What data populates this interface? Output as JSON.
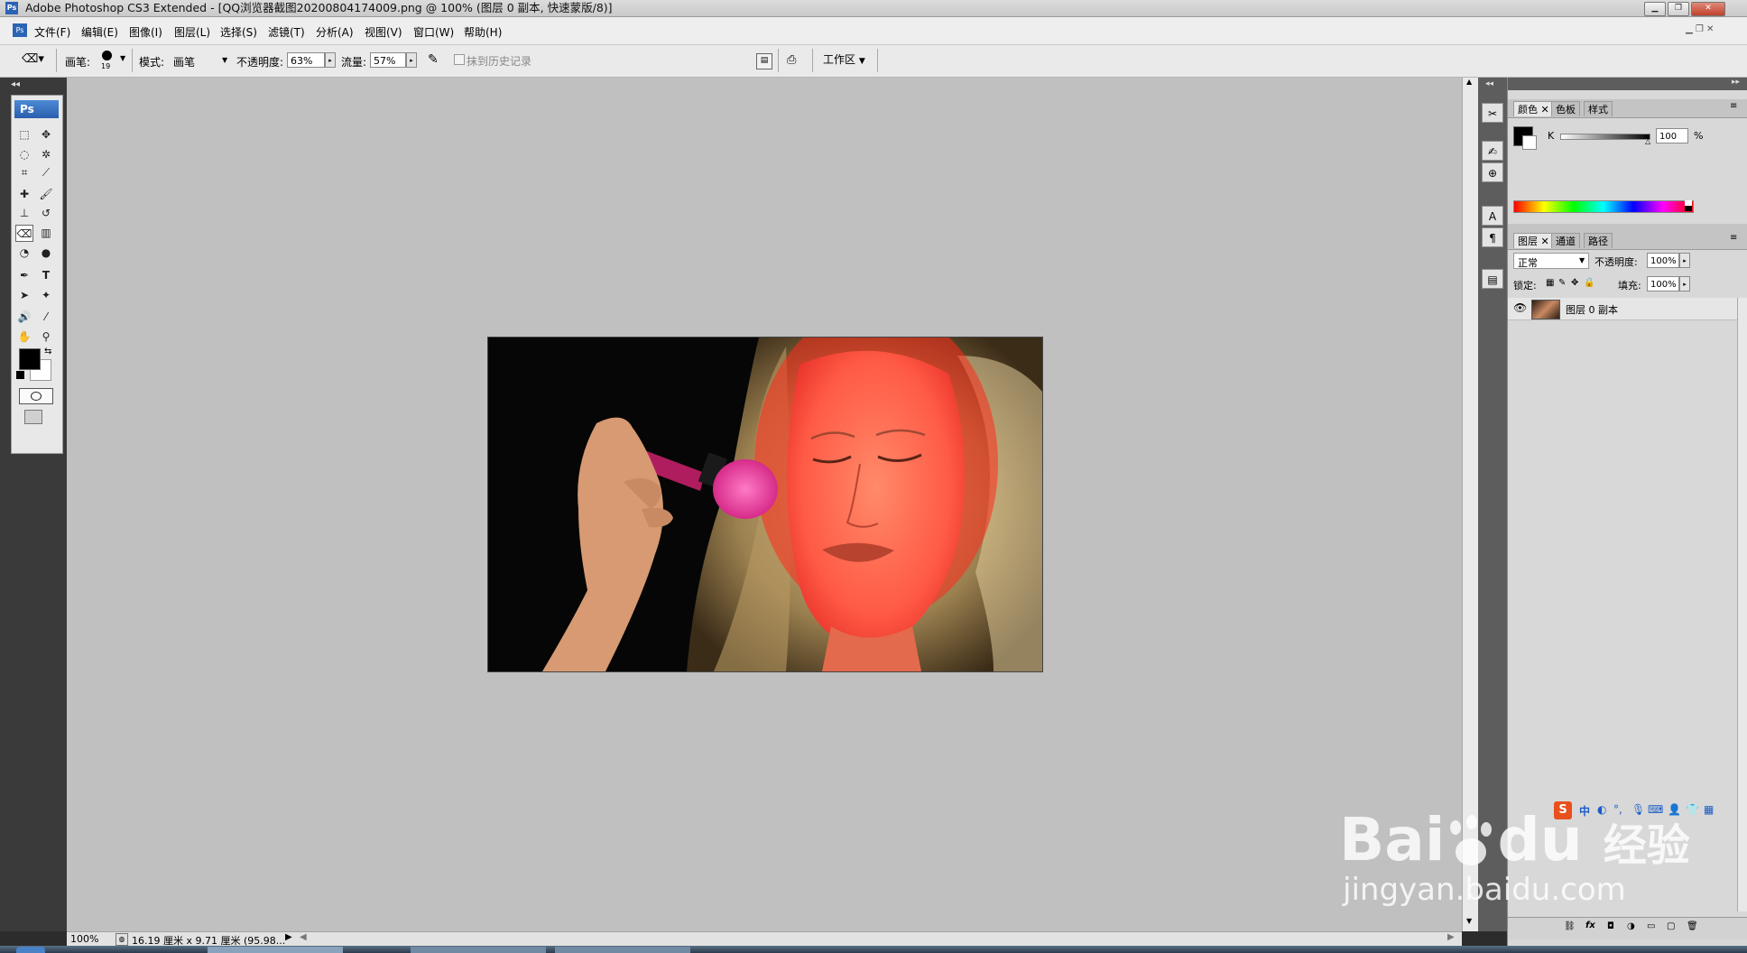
{
  "window": {
    "title": "Adobe Photoshop CS3 Extended - [QQ浏览器截图20200804174009.png @ 100% (图层 0 副本, 快速蒙版/8)]",
    "app_icon": "Ps"
  },
  "menu": {
    "items": [
      {
        "label": "文件(F)"
      },
      {
        "label": "编辑(E)"
      },
      {
        "label": "图像(I)"
      },
      {
        "label": "图层(L)"
      },
      {
        "label": "选择(S)"
      },
      {
        "label": "滤镜(T)"
      },
      {
        "label": "分析(A)"
      },
      {
        "label": "视图(V)"
      },
      {
        "label": "窗口(W)"
      },
      {
        "label": "帮助(H)"
      }
    ]
  },
  "options": {
    "brush_label": "画笔:",
    "brush_size": "19",
    "mode_label": "模式:",
    "mode_value": "画笔",
    "opacity_label": "不透明度:",
    "opacity_value": "63%",
    "flow_label": "流量:",
    "flow_value": "57%",
    "erase_history_label": "抹到历史记录",
    "workspace_label": "工作区"
  },
  "toolbox": {
    "logo": "Ps"
  },
  "status": {
    "zoom": "100%",
    "doc_info": "16.19 厘米 x 9.71 厘米 (95.98..."
  },
  "color_panel": {
    "tabs": [
      "颜色",
      "色板",
      "样式"
    ],
    "channel_label": "K",
    "channel_value": "100",
    "unit": "%"
  },
  "layers_panel": {
    "tabs": [
      "图层",
      "通道",
      "路径"
    ],
    "blend_mode": "正常",
    "opacity_label": "不透明度:",
    "opacity_value": "100%",
    "lock_label": "锁定:",
    "fill_label": "填充:",
    "fill_value": "100%",
    "layers": [
      {
        "name": "图层 0 副本",
        "visible": true
      }
    ]
  },
  "watermark": {
    "brand": "Bai",
    "brand2": "du",
    "jingyan": "经验",
    "url": "jingyan.baidu.com"
  },
  "ime_bar": {
    "label": "中"
  },
  "colors": {
    "workspace": "#c0c0c0",
    "quickmask_overlay": "#ff3b30",
    "brush_pink": "#e8379a"
  }
}
